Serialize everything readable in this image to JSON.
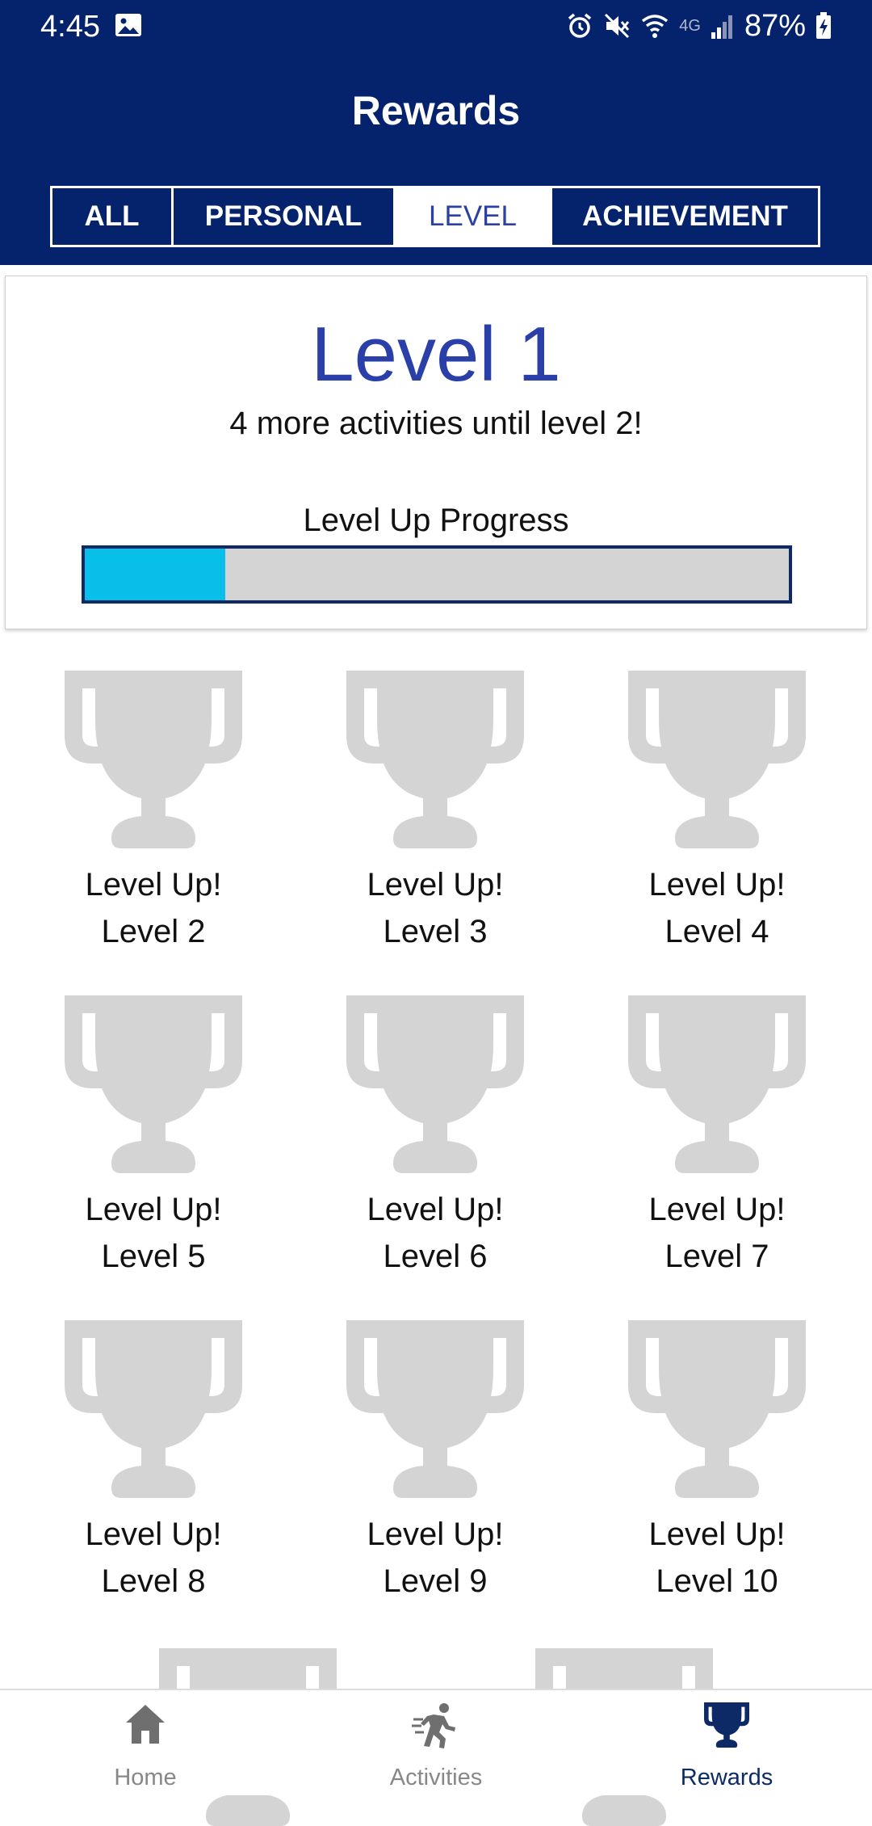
{
  "status_bar": {
    "time": "4:45",
    "battery": "87%",
    "network": "4G"
  },
  "header": {
    "title": "Rewards"
  },
  "tabs": [
    {
      "label": "ALL",
      "active": false
    },
    {
      "label": "PERSONAL",
      "active": false
    },
    {
      "label": "LEVEL",
      "active": true
    },
    {
      "label": "ACHIEVEMENT",
      "active": false
    }
  ],
  "level_card": {
    "title": "Level 1",
    "subtitle": "4 more activities until level 2!",
    "progress_label": "Level Up Progress",
    "progress": 0.2
  },
  "trophies": [
    {
      "title": "Level Up!",
      "level": "Level 2"
    },
    {
      "title": "Level Up!",
      "level": "Level 3"
    },
    {
      "title": "Level Up!",
      "level": "Level 4"
    },
    {
      "title": "Level Up!",
      "level": "Level 5"
    },
    {
      "title": "Level Up!",
      "level": "Level 6"
    },
    {
      "title": "Level Up!",
      "level": "Level 7"
    },
    {
      "title": "Level Up!",
      "level": "Level 8"
    },
    {
      "title": "Level Up!",
      "level": "Level 9"
    },
    {
      "title": "Level Up!",
      "level": "Level 10"
    }
  ],
  "bottom_nav": [
    {
      "label": "Home",
      "icon": "home-icon",
      "active": false
    },
    {
      "label": "Activities",
      "icon": "running-person-icon",
      "active": false
    },
    {
      "label": "Rewards",
      "icon": "trophy-icon",
      "active": true
    }
  ],
  "colors": {
    "brand_navy": "#05236c",
    "accent_blue": "#2a3fa8",
    "progress_fill": "#07bfe8",
    "trophy_locked": "#d4d4d4"
  }
}
